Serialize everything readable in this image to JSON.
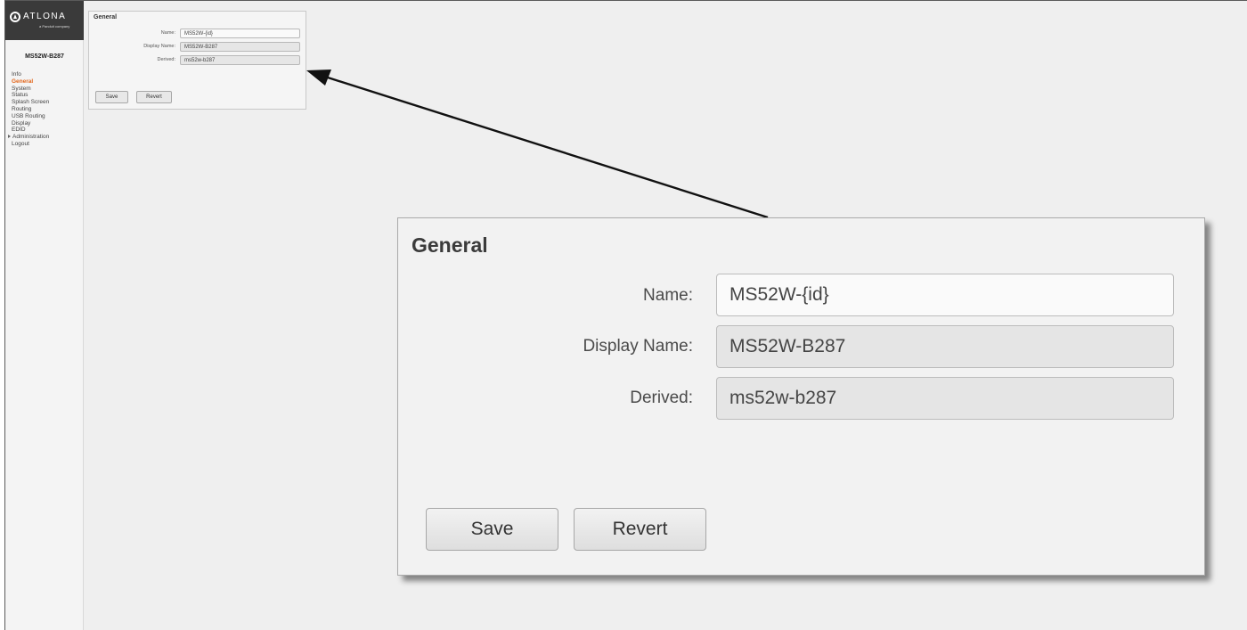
{
  "sidebar": {
    "logo": {
      "brand": "ATLONA",
      "tagline": "a Panduit company"
    },
    "device_name": "MS52W-B287",
    "items": [
      {
        "label": "Info",
        "active": false
      },
      {
        "label": "General",
        "active": true
      },
      {
        "label": "System",
        "active": false
      },
      {
        "label": "Status",
        "active": false
      },
      {
        "label": "Splash Screen",
        "active": false
      },
      {
        "label": "Routing",
        "active": false
      },
      {
        "label": "USB Routing",
        "active": false
      },
      {
        "label": "Display",
        "active": false
      },
      {
        "label": "EDID",
        "active": false
      },
      {
        "label": "Administration",
        "active": false,
        "expandable": true
      },
      {
        "label": "Logout",
        "active": false
      }
    ]
  },
  "general": {
    "title": "General",
    "fields": {
      "name": {
        "label": "Name:",
        "value": "MS52W-{id}"
      },
      "display_name": {
        "label": "Display Name:",
        "value": "MS52W-B287"
      },
      "derived": {
        "label": "Derived:",
        "value": "ms52w-b287"
      }
    },
    "buttons": {
      "save": "Save",
      "revert": "Revert"
    }
  },
  "colors": {
    "accent": "#e2661b",
    "sidebar_bg": "#f4f4f4",
    "logo_bg": "#3a3a3a",
    "content_bg": "#efefef"
  },
  "icons": {
    "logo": "atlona-logo-icon",
    "expand": "caret-right-icon",
    "callout": "callout-arrow-icon"
  }
}
